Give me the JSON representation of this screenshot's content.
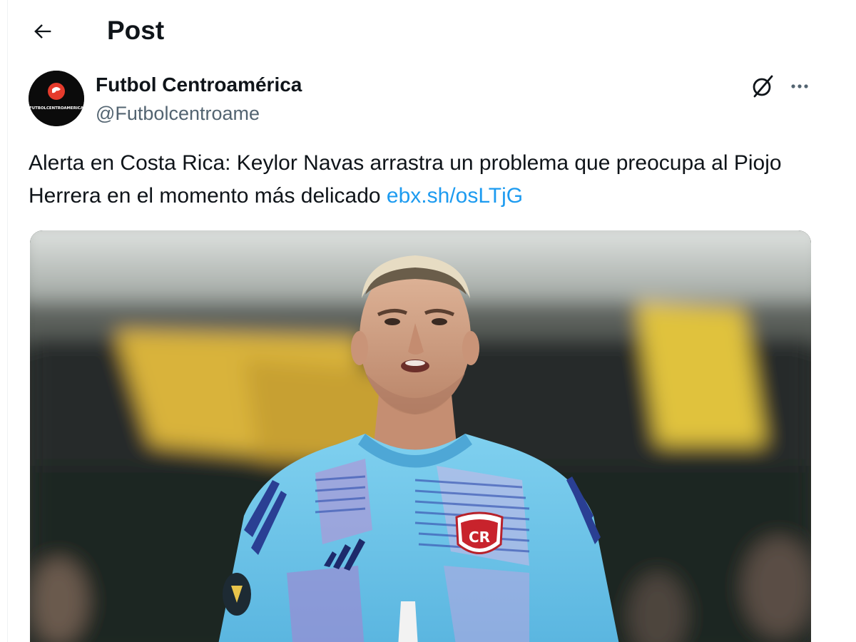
{
  "header": {
    "title": "Post",
    "back_icon": "arrow-left-icon"
  },
  "author": {
    "display_name": "Futbol Centroamérica",
    "handle": "@Futbolcentroame",
    "avatar_text": "FUTBOLCENTROAMERICA"
  },
  "actions": {
    "grok_icon": "grok-icon",
    "more_icon": "more-horizontal-icon"
  },
  "tweet": {
    "text": "Alerta en Costa Rica: Keylor Navas arrastra un problema que preocupa al Piojo Herrera en el momento más delicado ",
    "link": "ebx.sh/osLTjG"
  },
  "media": {
    "description_icon": "photo-goalkeeper",
    "crest_text": "CR"
  },
  "colors": {
    "text": "#0f1419",
    "secondary": "#536471",
    "link": "#1d9bf0",
    "jersey": "#6ec1e8"
  }
}
